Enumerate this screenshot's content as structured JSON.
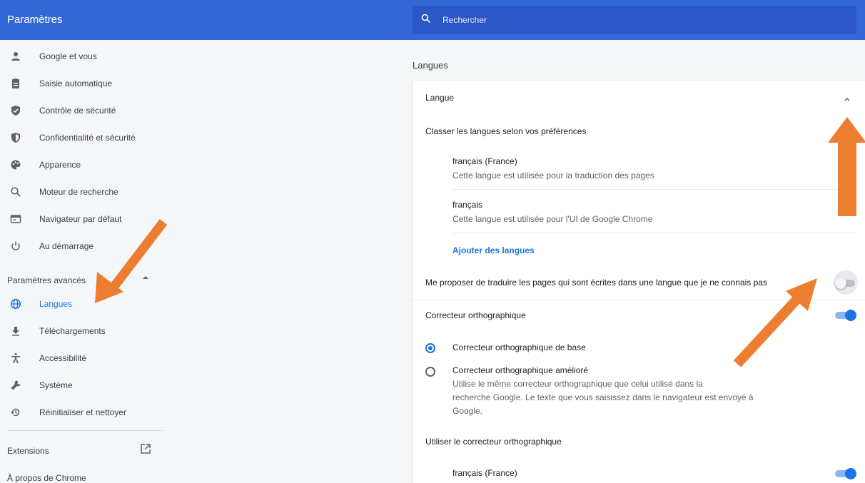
{
  "app": {
    "title": "Paramètres"
  },
  "search": {
    "placeholder": "Rechercher"
  },
  "sidebar": {
    "items": [
      {
        "label": "Google et vous",
        "icon": "person-icon"
      },
      {
        "label": "Saisie automatique",
        "icon": "clipboard-icon"
      },
      {
        "label": "Contrôle de sécurité",
        "icon": "shield-check-icon"
      },
      {
        "label": "Confidentialité et sécurité",
        "icon": "shield-icon"
      },
      {
        "label": "Apparence",
        "icon": "palette-icon"
      },
      {
        "label": "Moteur de recherche",
        "icon": "search-icon"
      },
      {
        "label": "Navigateur par défaut",
        "icon": "browser-icon"
      },
      {
        "label": "Au démarrage",
        "icon": "power-icon"
      }
    ],
    "advanced_label": "Paramètres avancés",
    "advanced_items": [
      {
        "label": "Langues",
        "icon": "globe-icon",
        "active": true
      },
      {
        "label": "Téléchargements",
        "icon": "download-icon"
      },
      {
        "label": "Accessibilité",
        "icon": "accessibility-icon"
      },
      {
        "label": "Système",
        "icon": "wrench-icon"
      },
      {
        "label": "Réinitialiser et nettoyer",
        "icon": "restore-icon"
      }
    ],
    "extensions_label": "Extensions",
    "about_label": "À propos de Chrome"
  },
  "main": {
    "section_title": "Langues",
    "language": {
      "header": "Langue",
      "order_label": "Classer les langues selon vos préférences",
      "languages": [
        {
          "name": "français (France)",
          "desc": "Cette langue est utilisée pour la traduction des pages"
        },
        {
          "name": "français",
          "desc": "Cette langue est utilisée pour l'UI de Google Chrome"
        }
      ],
      "add_link": "Ajouter des langues",
      "translate_offer": {
        "label": "Me proposer de traduire les pages qui sont écrites dans une langue que je ne connais pas",
        "enabled": false
      }
    },
    "spellcheck": {
      "label": "Correcteur orthographique",
      "enabled": true,
      "options": [
        {
          "label": "Correcteur orthographique de base",
          "checked": true
        },
        {
          "label": "Correcteur orthographique amélioré",
          "checked": false,
          "desc_lines": [
            "Utilise le même correcteur orthographique que celui utilisé dans la",
            "recherche Google. Le texte que vous saisissez dans le navigateur est envoyé à",
            "Google."
          ]
        }
      ],
      "use_label": "Utiliser le correcteur orthographique",
      "use_languages": [
        {
          "name": "français (France)",
          "enabled": true
        }
      ]
    }
  },
  "colors": {
    "header": "#3367d6",
    "accent": "#1a73e8",
    "annotation_arrow": "#ed7d31"
  }
}
